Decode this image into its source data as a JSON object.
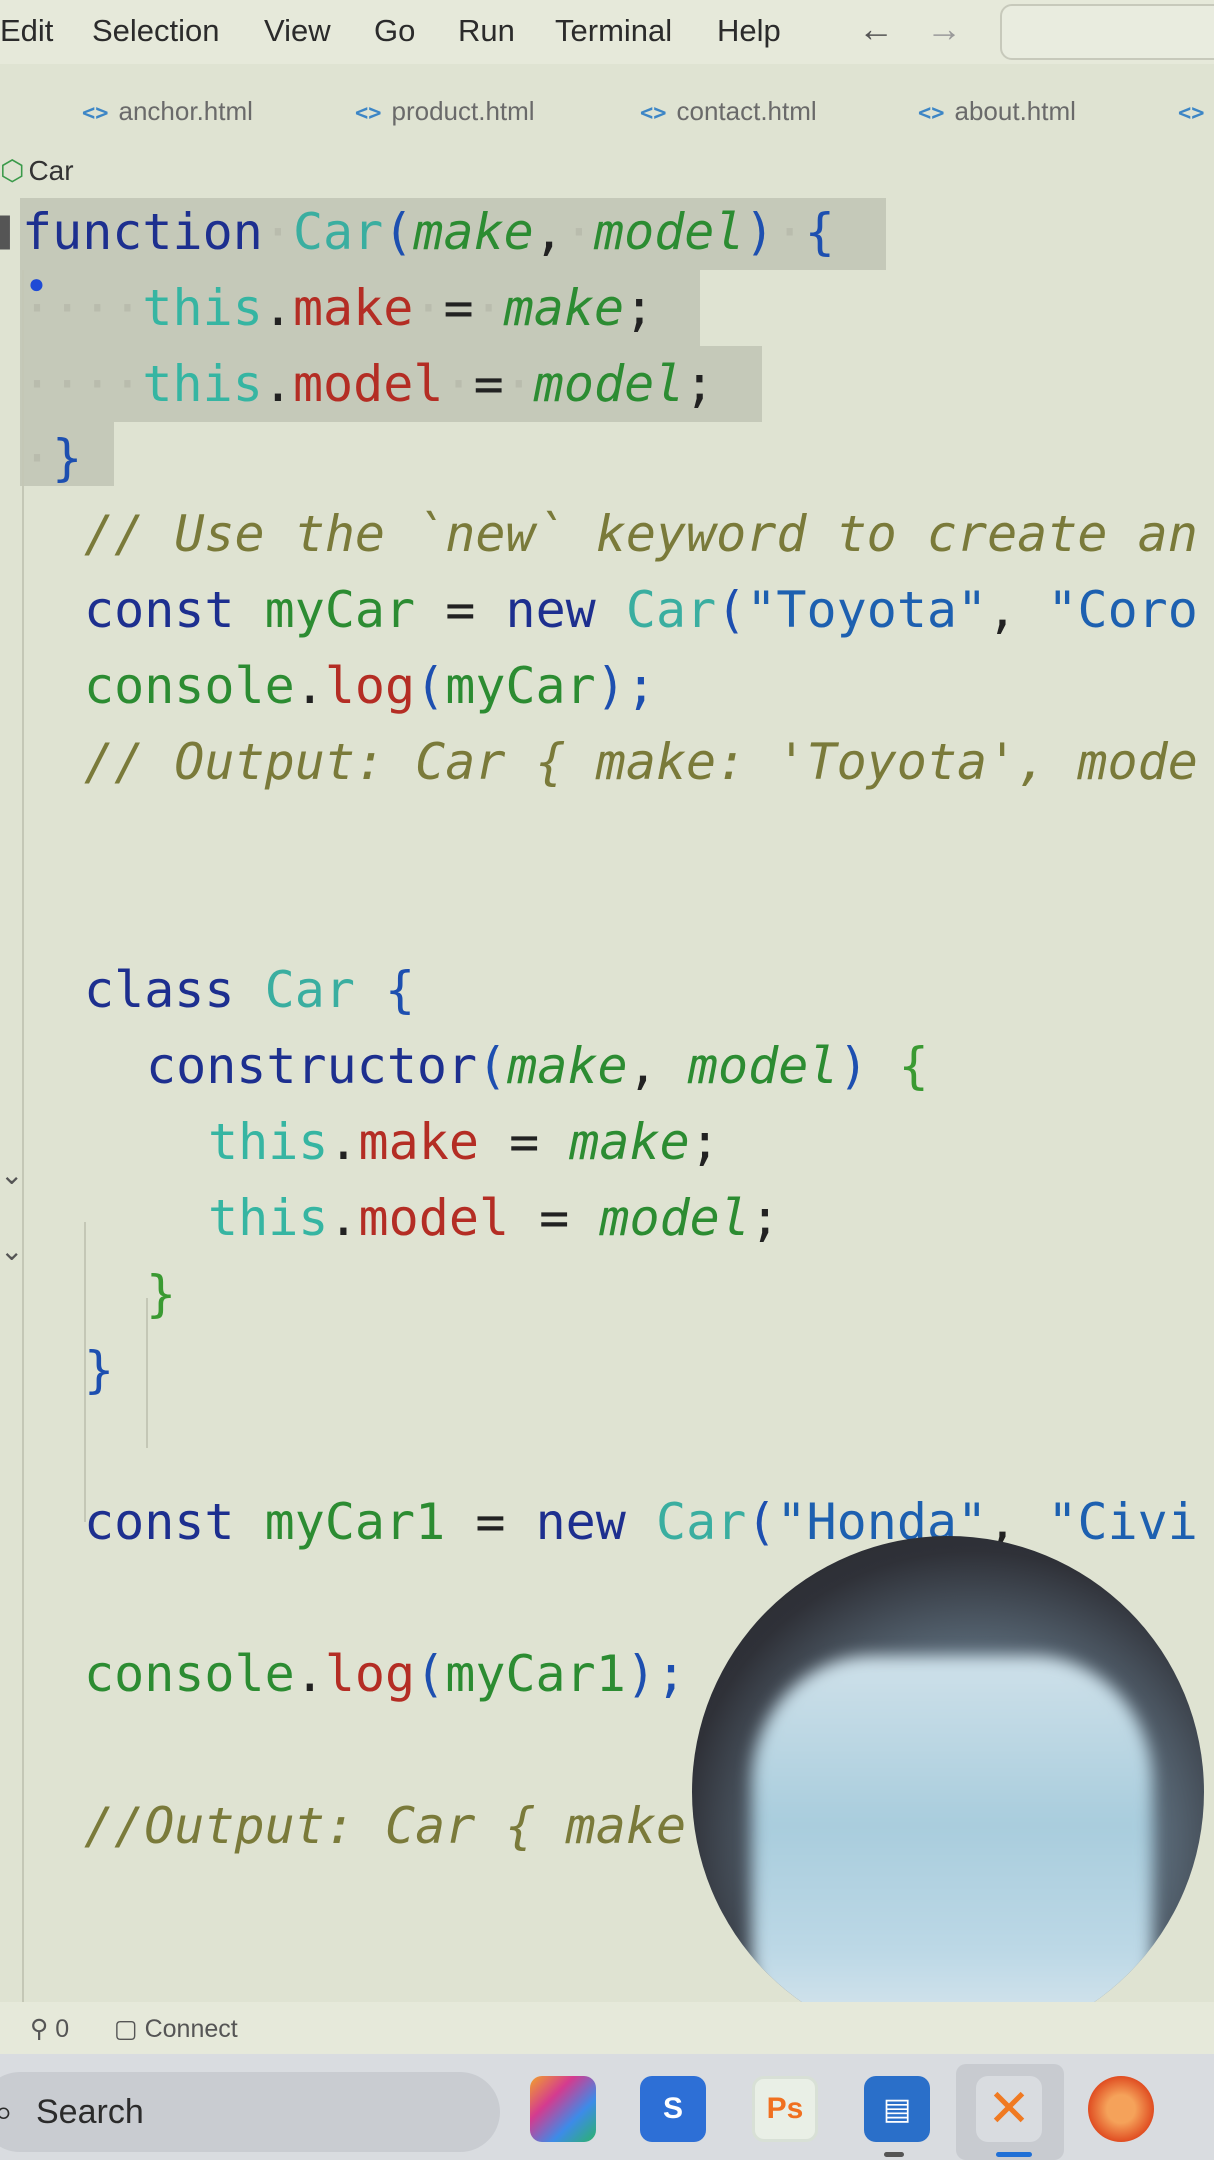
{
  "menu": {
    "items": [
      "Edit",
      "Selection",
      "View",
      "Go",
      "Run",
      "Terminal",
      "Help"
    ],
    "back_arrow": "←",
    "forward_arrow": "→"
  },
  "tabs": [
    {
      "icon": "<>",
      "label": "anchor.html"
    },
    {
      "icon": "<>",
      "label": "product.html"
    },
    {
      "icon": "<>",
      "label": "contact.html"
    },
    {
      "icon": "<>",
      "label": "about.html"
    },
    {
      "icon": "<>",
      "label": ""
    }
  ],
  "breadcrumb": {
    "label": "Car"
  },
  "code": {
    "l1": {
      "kw": "function",
      "name": "Car",
      "open": "(",
      "p1": "make",
      "comma": ",",
      "p2": "model",
      "close": ")",
      "brace": "{"
    },
    "l2": {
      "this": "this",
      "dot": ".",
      "prop": "make",
      "eq": "=",
      "val": "make",
      "semi": ";"
    },
    "l3": {
      "this": "this",
      "dot": ".",
      "prop": "model",
      "eq": "=",
      "val": "model",
      "semi": ";"
    },
    "l4": {
      "brace": "}"
    },
    "l5": {
      "comment": "// Use the `new` keyword to create an"
    },
    "l6": {
      "kw": "const",
      "var": "myCar",
      "eq": "=",
      "new": "new",
      "cls": "Car",
      "open": "(",
      "s1": "\"Toyota\"",
      "comma": ",",
      "s2": "\"Coro"
    },
    "l7": {
      "obj": "console",
      "dot": ".",
      "method": "log",
      "open": "(",
      "arg": "myCar",
      "close": ");"
    },
    "l8": {
      "comment": "// Output: Car { make: 'Toyota', mode"
    },
    "l9": {
      "kw": "class",
      "cls": "Car",
      "brace": "{"
    },
    "l10": {
      "ctor": "constructor",
      "open": "(",
      "p1": "make",
      "comma": ",",
      "p2": "model",
      "close": ")",
      "brace": "{"
    },
    "l11": {
      "this": "this",
      "dot": ".",
      "prop": "make",
      "eq": "=",
      "val": "make",
      "semi": ";"
    },
    "l12": {
      "this": "this",
      "dot": ".",
      "prop": "model",
      "eq": "=",
      "val": "model",
      "semi": ";"
    },
    "l13": {
      "brace": "}"
    },
    "l14": {
      "brace": "}"
    },
    "l15": {
      "kw": "const",
      "var": "myCar1",
      "eq": "=",
      "new": "new",
      "cls": "Car",
      "open": "(",
      "s1": "\"Honda\"",
      "comma": ",",
      "s2": "\"Civi"
    },
    "l16": {
      "obj": "console",
      "dot": ".",
      "method": "log",
      "open": "(",
      "arg": "myCar1",
      "close": ");"
    },
    "l17": {
      "comment": "//Output: Car { make"
    }
  },
  "status": {
    "ports": "0",
    "connect": "Connect"
  },
  "taskbar": {
    "search": "Search",
    "apps": [
      "Copilot",
      "Sublime Text",
      "Photoshop",
      "File Explorer",
      "Visual Studio Code",
      "Microsoft Edge"
    ]
  },
  "colors": {
    "editor_bg": "#dfe3d2",
    "selection": "#c5c9b9",
    "keyword": "#1d2f8f",
    "this": "#36b5a2",
    "property": "#b42d24",
    "parameter": "#2c8c32",
    "string": "#1d60b0",
    "comment": "#7a7a3a"
  }
}
